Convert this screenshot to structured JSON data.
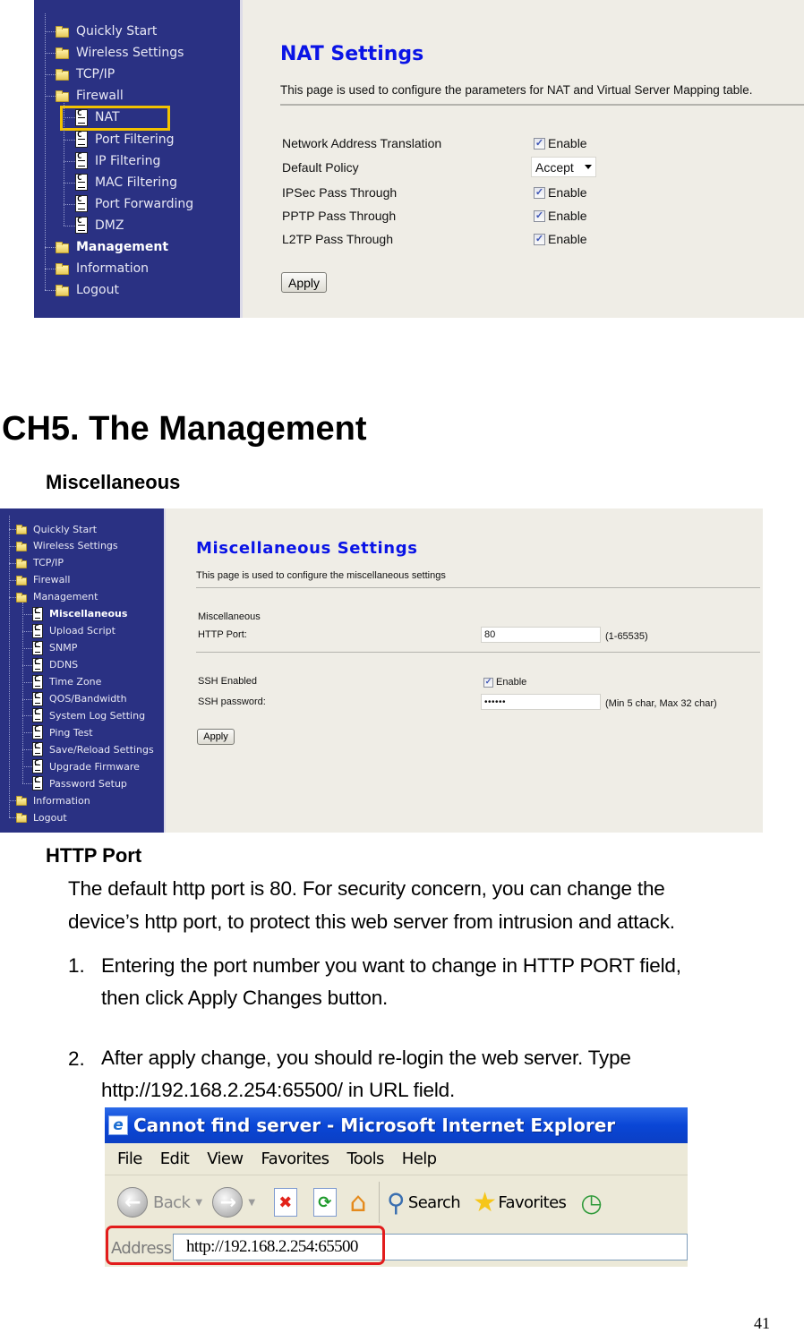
{
  "screenshot_nat": {
    "nav_items": [
      {
        "label": "Quickly Start",
        "type": "folder",
        "level": 0
      },
      {
        "label": "Wireless Settings",
        "type": "folder",
        "level": 0
      },
      {
        "label": "TCP/IP",
        "type": "folder",
        "level": 0
      },
      {
        "label": "Firewall",
        "type": "folder-open",
        "level": 0
      },
      {
        "label": "NAT",
        "type": "page",
        "level": 1,
        "highlighted": true
      },
      {
        "label": "Port Filtering",
        "type": "page",
        "level": 1
      },
      {
        "label": "IP Filtering",
        "type": "page",
        "level": 1
      },
      {
        "label": "MAC Filtering",
        "type": "page",
        "level": 1
      },
      {
        "label": "Port Forwarding",
        "type": "page",
        "level": 1
      },
      {
        "label": "DMZ",
        "type": "page",
        "level": 1
      },
      {
        "label": "Management",
        "type": "folder",
        "level": 0,
        "bold": true
      },
      {
        "label": "Information",
        "type": "folder",
        "level": 0
      },
      {
        "label": "Logout",
        "type": "folder",
        "level": 0
      }
    ],
    "title": "NAT Settings",
    "description": "This page is used to configure the parameters for NAT and Virtual Server Mapping table.",
    "rows": [
      {
        "label": "Network Address Translation",
        "control": "checkbox",
        "checked": true,
        "text": "Enable"
      },
      {
        "label": "Default Policy",
        "control": "select",
        "value": "Accept"
      },
      {
        "label": "IPSec Pass Through",
        "control": "checkbox",
        "checked": true,
        "text": "Enable"
      },
      {
        "label": "PPTP Pass Through",
        "control": "checkbox",
        "checked": true,
        "text": "Enable"
      },
      {
        "label": "L2TP Pass Through",
        "control": "checkbox",
        "checked": true,
        "text": "Enable"
      }
    ],
    "apply_label": "Apply",
    "highlight_color": "#f2c200"
  },
  "chapter": {
    "title": "CH5. The Management",
    "section": "Miscellaneous"
  },
  "screenshot_misc": {
    "nav_items": [
      {
        "label": "Quickly Start",
        "type": "folder",
        "level": 0
      },
      {
        "label": "Wireless Settings",
        "type": "folder",
        "level": 0
      },
      {
        "label": "TCP/IP",
        "type": "folder",
        "level": 0
      },
      {
        "label": "Firewall",
        "type": "folder",
        "level": 0
      },
      {
        "label": "Management",
        "type": "folder-open",
        "level": 0
      },
      {
        "label": "Miscellaneous",
        "type": "page",
        "level": 1,
        "bold": true
      },
      {
        "label": "Upload Script",
        "type": "page",
        "level": 1
      },
      {
        "label": "SNMP",
        "type": "page",
        "level": 1
      },
      {
        "label": "DDNS",
        "type": "page",
        "level": 1
      },
      {
        "label": "Time Zone",
        "type": "page",
        "level": 1
      },
      {
        "label": "QOS/Bandwidth",
        "type": "page",
        "level": 1
      },
      {
        "label": "System Log Setting",
        "type": "page",
        "level": 1
      },
      {
        "label": "Ping Test",
        "type": "page",
        "level": 1
      },
      {
        "label": "Save/Reload Settings",
        "type": "page",
        "level": 1
      },
      {
        "label": "Upgrade Firmware",
        "type": "page",
        "level": 1
      },
      {
        "label": "Password Setup",
        "type": "page",
        "level": 1
      },
      {
        "label": "Information",
        "type": "folder",
        "level": 0
      },
      {
        "label": "Logout",
        "type": "folder",
        "level": 0
      }
    ],
    "title": "Miscellaneous Settings",
    "description": "This page is used to configure the miscellaneous settings",
    "group_label": "Miscellaneous",
    "http_port_label": "HTTP Port:",
    "http_port_value": "80",
    "http_port_hint": "(1-65535)",
    "ssh_enabled_label": "SSH Enabled",
    "ssh_enabled_checked": true,
    "ssh_enabled_text": "Enable",
    "ssh_password_label": "SSH password:",
    "ssh_password_value": "••••••",
    "ssh_password_hint": "(Min 5 char, Max 32 char)",
    "apply_label": "Apply"
  },
  "http_port_section": {
    "heading": "HTTP Port",
    "paragraph_line1": "The default http port is 80. For security concern, you can change the",
    "paragraph_line2": "device’s http port, to protect this web server from intrusion and attack.",
    "steps": [
      {
        "num": "1.",
        "line1": "Entering the port number you want to change in HTTP PORT field,",
        "line2": "then click Apply Changes button."
      },
      {
        "num": "2.",
        "line1": "After apply change, you should re-login the web server. Type",
        "line2": "http://192.168.2.254:65500/ in URL field."
      }
    ]
  },
  "browser": {
    "window_title": "Cannot find server - Microsoft Internet Explorer",
    "menu": [
      "File",
      "Edit",
      "View",
      "Favorites",
      "Tools",
      "Help"
    ],
    "toolbar": {
      "back_label": "Back",
      "search_label": "Search",
      "favorites_label": "Favorites"
    },
    "address_label": "Address",
    "address_value": "http://192.168.2.254:65500",
    "highlight_color": "#e21c1c"
  },
  "page_number": "41"
}
